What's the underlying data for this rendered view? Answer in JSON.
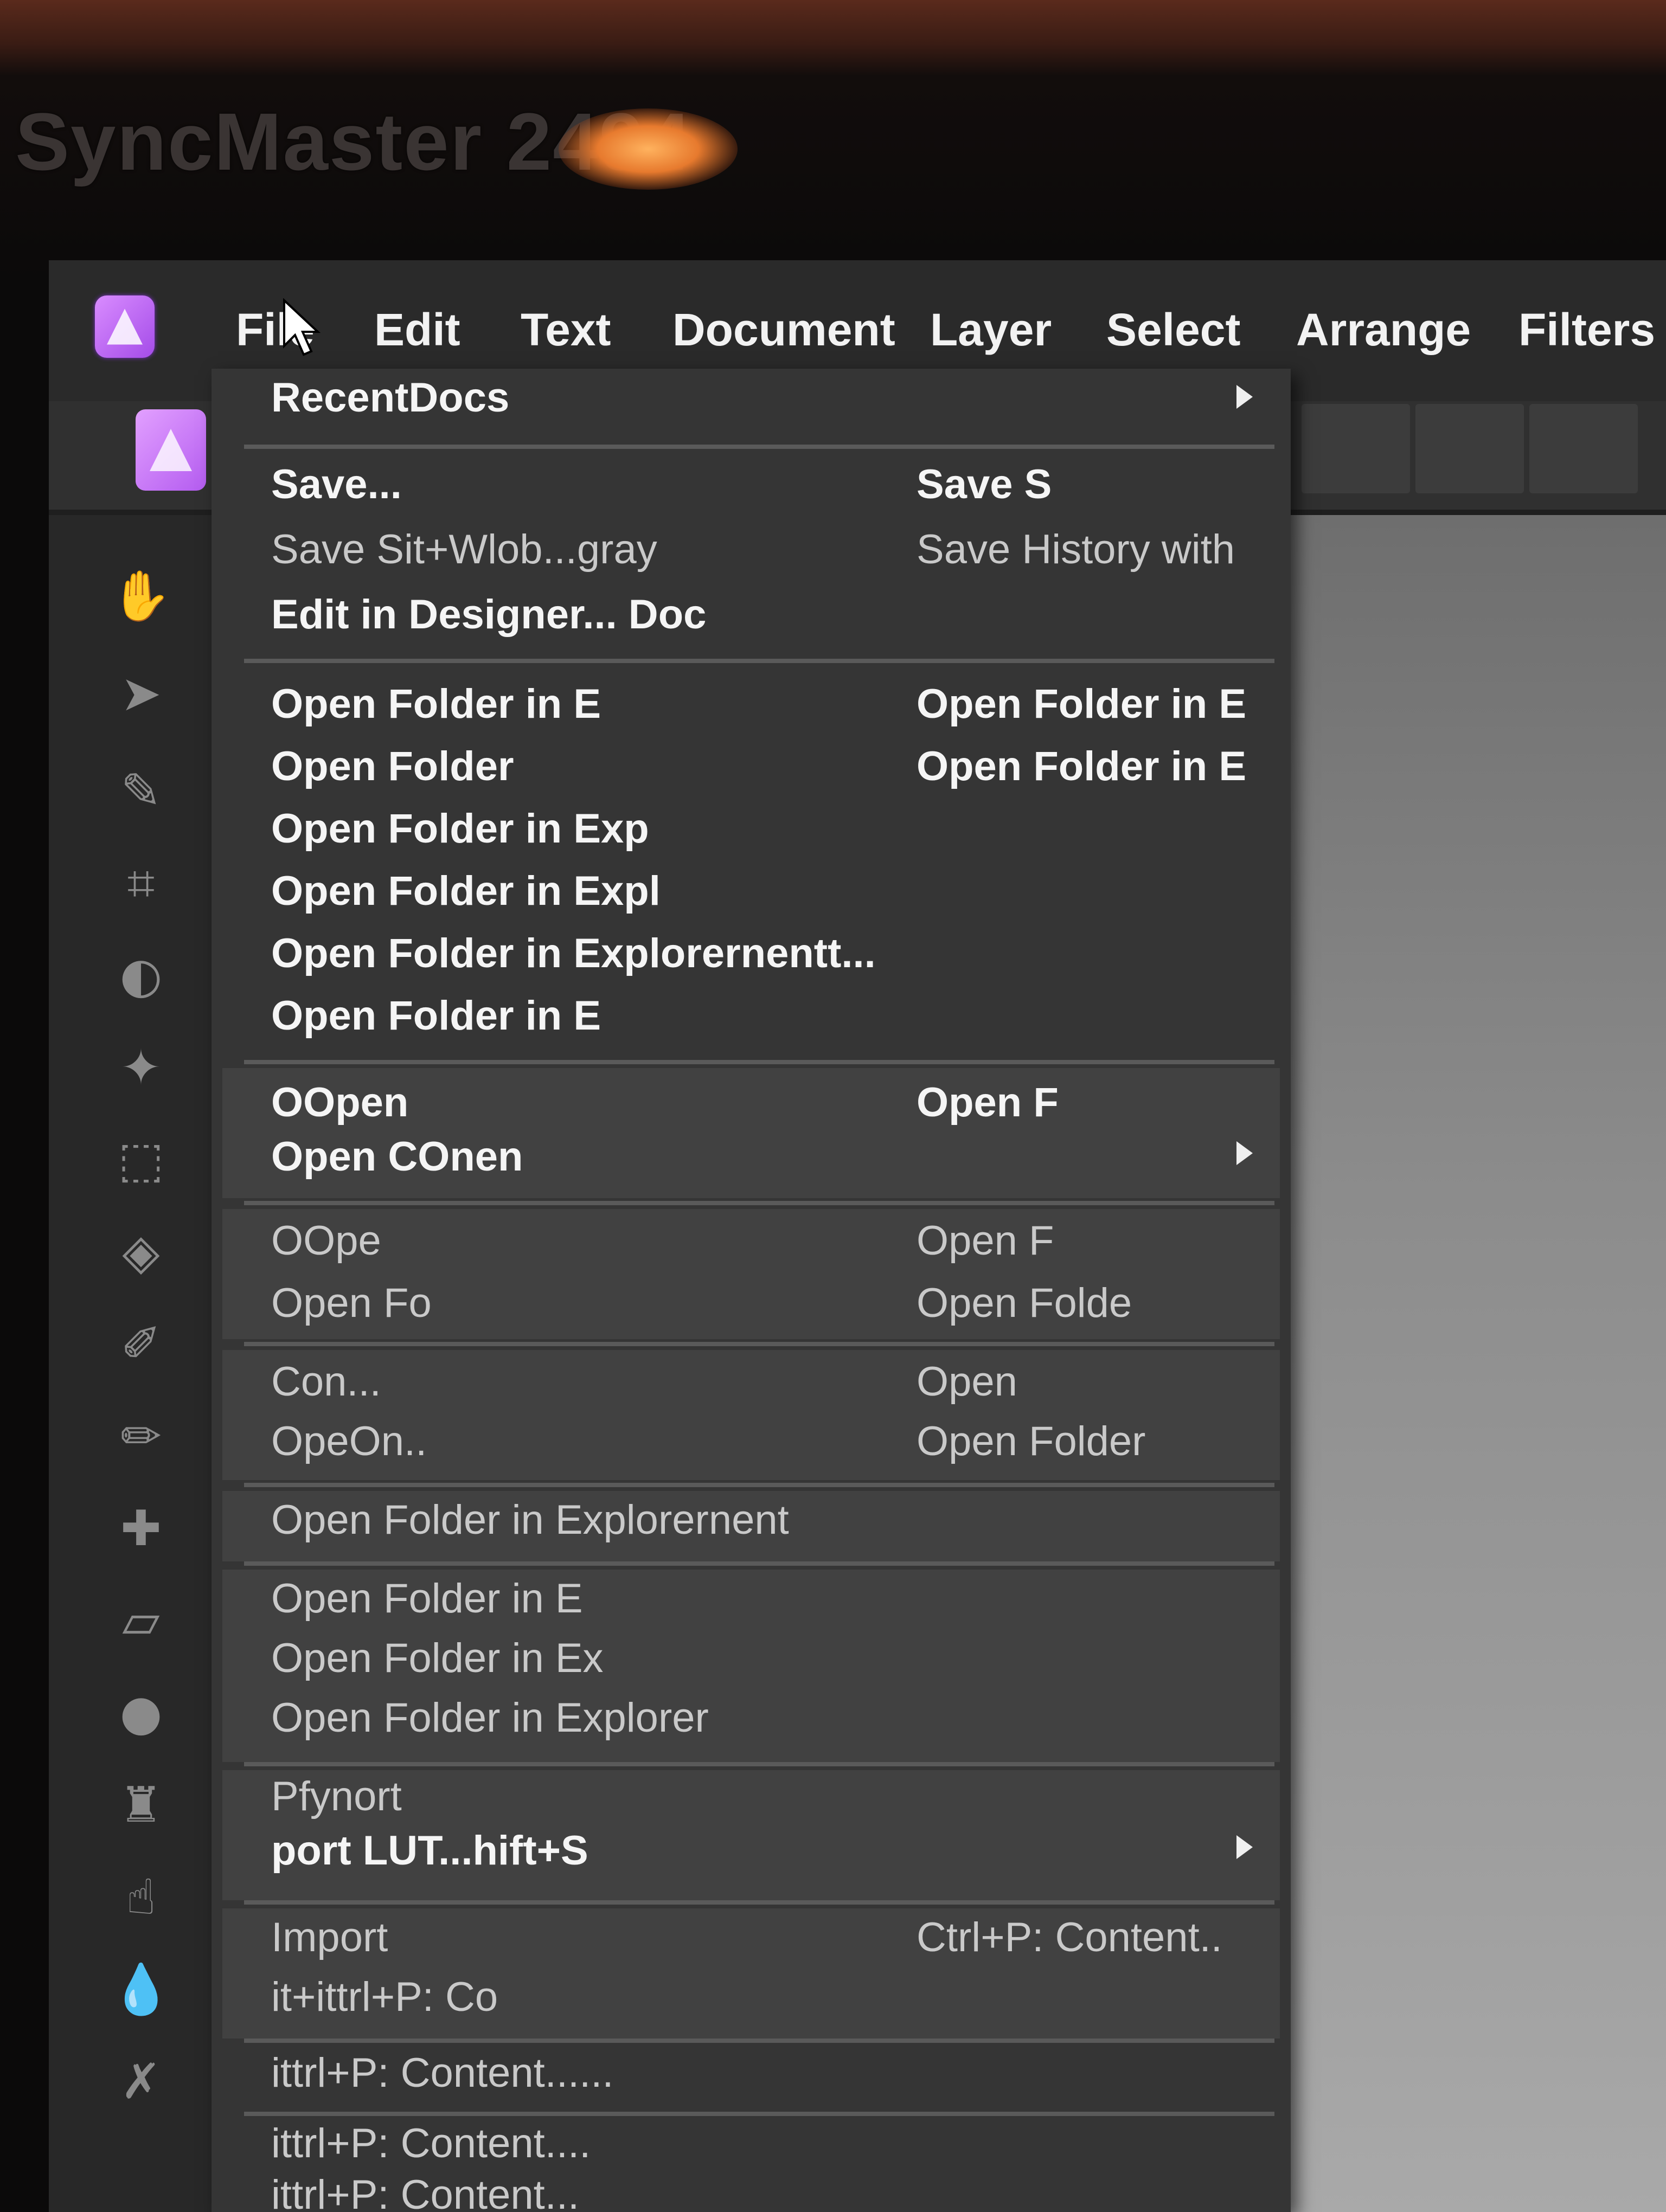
{
  "monitor": {
    "brand": "SyncMaster 2494"
  },
  "menubar": {
    "items": [
      "File",
      "Edit",
      "Text",
      "Document",
      "Layer",
      "Select",
      "Arrange",
      "Filters"
    ]
  },
  "file_menu": {
    "items": [
      {
        "label": "RecentDocs",
        "shortcut": ""
      },
      {
        "label": "Save...",
        "shortcut": "Save S"
      },
      {
        "label": "Save Sit+Wlob...gray",
        "shortcut": "Save History with"
      },
      {
        "label": "Edit in Designer... Doc",
        "shortcut": ""
      },
      {
        "label": "Open Folder in E",
        "shortcut": "Open Folder in E"
      },
      {
        "label": "Open Folder",
        "shortcut": "Open Folder in E"
      },
      {
        "label": "Open Folder in Exp",
        "shortcut": ""
      },
      {
        "label": "Open Folder in Expl",
        "shortcut": ""
      },
      {
        "label": "Open Folder in Explorernentt...",
        "shortcut": ""
      },
      {
        "label": "Open Folder in E",
        "shortcut": ""
      },
      {
        "label": "OOpen",
        "shortcut": "Open F"
      },
      {
        "label": "Open COnen",
        "shortcut": ""
      },
      {
        "label": "OOpe",
        "shortcut": "Open F"
      },
      {
        "label": "Open Fo",
        "shortcut": "Open Folde"
      },
      {
        "label": "Con...",
        "shortcut": "Open"
      },
      {
        "label": "OpeOn..",
        "shortcut": "Open Folder"
      },
      {
        "label": "Open Folder in Explorernent",
        "shortcut": ""
      },
      {
        "label": "Open Folder in E",
        "shortcut": ""
      },
      {
        "label": "Open Folder in Ex",
        "shortcut": ""
      },
      {
        "label": "Open Folder in Explorer",
        "shortcut": ""
      },
      {
        "label": "Pfynort",
        "shortcut": ""
      },
      {
        "label": "port LUT...hift+S",
        "shortcut": ""
      },
      {
        "label": "Import",
        "shortcut": "Ctrl+P: Content.."
      },
      {
        "label": "it+ittrl+P: Co",
        "shortcut": ""
      },
      {
        "label": "ittrl+P: Content......",
        "shortcut": ""
      },
      {
        "label": "ittrl+P: Content....",
        "shortcut": ""
      },
      {
        "label": "ittrl+P: Content...",
        "shortcut": ""
      }
    ]
  }
}
